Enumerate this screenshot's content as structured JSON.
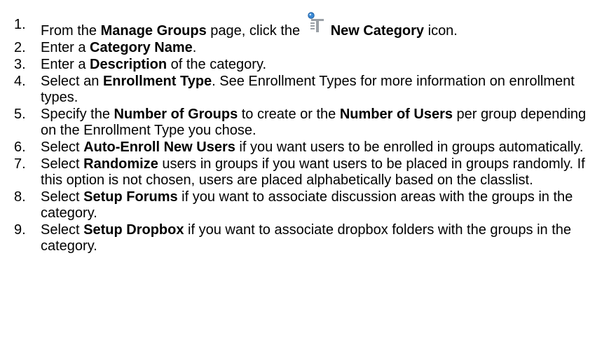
{
  "steps": [
    {
      "num": "1.",
      "parts": [
        {
          "t": "From the ",
          "b": false
        },
        {
          "t": "Manage Groups",
          "b": true
        },
        {
          "t": " page, click the ",
          "b": false
        },
        {
          "icon": "new-category-icon"
        },
        {
          "t": "New Category",
          "b": true
        },
        {
          "t": " icon.",
          "b": false
        }
      ]
    },
    {
      "num": "2.",
      "parts": [
        {
          "t": "Enter a ",
          "b": false
        },
        {
          "t": "Category Name",
          "b": true
        },
        {
          "t": ".",
          "b": false
        }
      ]
    },
    {
      "num": "3.",
      "parts": [
        {
          "t": "Enter a ",
          "b": false
        },
        {
          "t": "Description",
          "b": true
        },
        {
          "t": " of the category.",
          "b": false
        }
      ]
    },
    {
      "num": "4.",
      "parts": [
        {
          "t": "Select an ",
          "b": false
        },
        {
          "t": "Enrollment Type",
          "b": true
        },
        {
          "t": ". See Enrollment Types for more information on enrollment types.",
          "b": false
        }
      ]
    },
    {
      "num": "5.",
      "parts": [
        {
          "t": "Specify the ",
          "b": false
        },
        {
          "t": "Number of Groups",
          "b": true
        },
        {
          "t": " to create or the ",
          "b": false
        },
        {
          "t": "Number of Users",
          "b": true
        },
        {
          "t": " per group depending on the Enrollment Type you chose.",
          "b": false
        }
      ]
    },
    {
      "num": "6.",
      "parts": [
        {
          "t": "Select ",
          "b": false
        },
        {
          "t": "Auto-Enroll New Users",
          "b": true
        },
        {
          "t": " if you want users to be enrolled in groups automatically.",
          "b": false
        }
      ]
    },
    {
      "num": "7.",
      "parts": [
        {
          "t": "Select ",
          "b": false
        },
        {
          "t": "Randomize",
          "b": true
        },
        {
          "t": " users in groups if you want users to be placed in groups randomly. If this option is not chosen, users are placed alphabetically based on the classlist.",
          "b": false
        }
      ]
    },
    {
      "num": "8.",
      "parts": [
        {
          "t": "Select ",
          "b": false
        },
        {
          "t": "Setup Forums",
          "b": true
        },
        {
          "t": " if you want to associate discussion areas with the groups in the category.",
          "b": false
        }
      ]
    },
    {
      "num": "9.",
      "parts": [
        {
          "t": "Select ",
          "b": false
        },
        {
          "t": "Setup Dropbox",
          "b": true
        },
        {
          "t": " if you want to associate dropbox folders with the groups in the category.",
          "b": false
        }
      ]
    }
  ],
  "colors": {
    "icon_blue": "#3a8ad6",
    "icon_gray": "#9aa0a6",
    "text": "#000000"
  }
}
